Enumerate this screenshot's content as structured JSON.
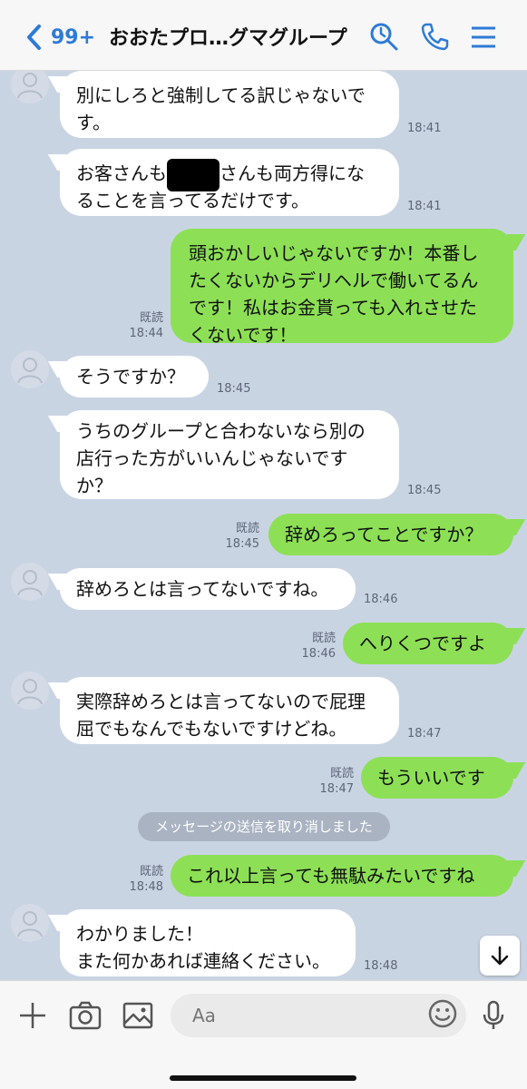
{
  "header": {
    "unread_count": "99+",
    "title": "おおたプロ…グマグループ",
    "icons": [
      "back-chevron-icon",
      "search-icon",
      "phone-icon",
      "menu-icon"
    ],
    "accent_color": "#2e7bd6"
  },
  "messages": [
    {
      "direction": "in",
      "lines": [
        "別にしろと強制してる訳じゃないで",
        "す。"
      ],
      "time": "18:41"
    },
    {
      "direction": "in",
      "line1_pre": "お客さんも",
      "line1_post": "さんも両方得にな",
      "line2": "ることを言ってるだけです。",
      "time": "18:41"
    },
    {
      "direction": "out",
      "lines": [
        "頭おかしいじゃないですか！本番し",
        "たくないからデリヘルで働いてるん",
        "です！私はお金貰っても入れさせた",
        "くないです！"
      ],
      "read": "既読",
      "time": "18:44"
    },
    {
      "direction": "in",
      "lines": [
        "そうですか？"
      ],
      "time": "18:45"
    },
    {
      "direction": "in",
      "lines": [
        "うちのグループと合わないなら別の",
        "店行った方がいいんじゃないです",
        "か？"
      ],
      "time": "18:45"
    },
    {
      "direction": "out",
      "lines": [
        "辞めろってことですか？"
      ],
      "read": "既読",
      "time": "18:45"
    },
    {
      "direction": "in",
      "lines": [
        "辞めろとは言ってないですね。"
      ],
      "time": "18:46"
    },
    {
      "direction": "out",
      "lines": [
        "へりくつですよ"
      ],
      "read": "既読",
      "time": "18:46"
    },
    {
      "direction": "in",
      "lines": [
        "実際辞めろとは言ってないので屁理",
        "屈でもなんでもないですけどね。"
      ],
      "time": "18:47"
    },
    {
      "direction": "out",
      "lines": [
        "もういいです"
      ],
      "read": "既読",
      "time": "18:47"
    },
    {
      "direction": "out",
      "lines": [
        "これ以上言っても無駄みたいですね"
      ],
      "read": "既読",
      "time": "18:48"
    },
    {
      "direction": "in",
      "lines": [
        "わかりました！",
        "また何かあれば連絡ください。"
      ],
      "time": "18:48"
    }
  ],
  "system_message": "メッセージの送信を取り消しました",
  "input": {
    "placeholder": "Aa",
    "icons": [
      "plus-icon",
      "camera-icon",
      "image-icon",
      "emoji-icon",
      "microphone-icon"
    ]
  },
  "colors": {
    "chat_bg": "#c9d4e3",
    "incoming_bubble": "#ffffff",
    "outgoing_bubble": "#8de055"
  }
}
